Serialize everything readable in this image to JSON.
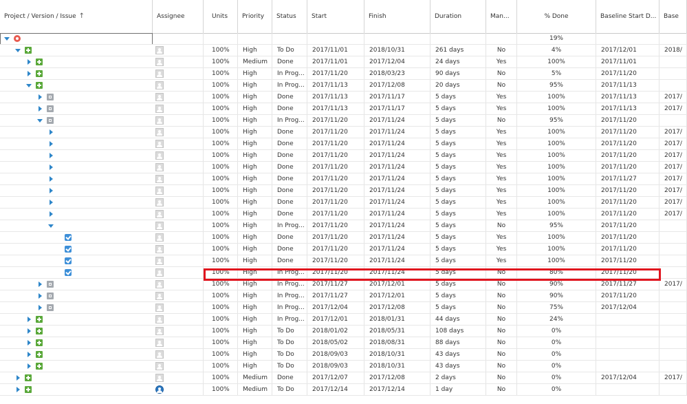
{
  "columns": [
    {
      "key": "tree",
      "label": "Project / Version / Issue",
      "sort_icon": "↑"
    },
    {
      "key": "assignee",
      "label": "Assignee"
    },
    {
      "key": "units",
      "label": "Units"
    },
    {
      "key": "priority",
      "label": "Priority"
    },
    {
      "key": "status",
      "label": "Status"
    },
    {
      "key": "start",
      "label": "Start"
    },
    {
      "key": "finish",
      "label": "Finish"
    },
    {
      "key": "duration",
      "label": "Duration"
    },
    {
      "key": "manual",
      "label": "Man..."
    },
    {
      "key": "done",
      "label": "% Done"
    },
    {
      "key": "bstart",
      "label": "Baseline Start D..."
    },
    {
      "key": "base",
      "label": "Base"
    }
  ],
  "colors": {
    "accent": "#2e86c9",
    "highlight": "#e0141e",
    "epic": "#5aa83a"
  },
  "rows": [
    {
      "level": 0,
      "toggle": "down",
      "icon": "project-icon",
      "avatar": "",
      "units": "",
      "priority": "",
      "status": "",
      "start": "",
      "finish": "",
      "duration": "",
      "manual": "",
      "done": "19%",
      "bstart": "",
      "base": ""
    },
    {
      "level": 1,
      "toggle": "down",
      "icon": "epic-icon",
      "avatar": "default",
      "units": "100%",
      "priority": "High",
      "status": "To Do",
      "start": "2017/11/01",
      "finish": "2018/10/31",
      "duration": "261 days",
      "manual": "No",
      "done": "4%",
      "bstart": "2017/12/01",
      "base": "2018/"
    },
    {
      "level": 2,
      "toggle": "right",
      "icon": "epic-icon",
      "avatar": "default",
      "units": "100%",
      "priority": "Medium",
      "status": "Done",
      "start": "2017/11/01",
      "finish": "2017/12/04",
      "duration": "24 days",
      "manual": "Yes",
      "done": "100%",
      "bstart": "2017/11/01",
      "base": ""
    },
    {
      "level": 2,
      "toggle": "right",
      "icon": "epic-icon",
      "avatar": "default",
      "units": "100%",
      "priority": "High",
      "status": "In Prog...",
      "start": "2017/11/20",
      "finish": "2018/03/23",
      "duration": "90 days",
      "manual": "No",
      "done": "5%",
      "bstart": "2017/11/20",
      "base": ""
    },
    {
      "level": 2,
      "toggle": "down",
      "icon": "epic-icon",
      "avatar": "default",
      "units": "100%",
      "priority": "High",
      "status": "In Prog...",
      "start": "2017/11/13",
      "finish": "2017/12/08",
      "duration": "20 days",
      "manual": "No",
      "done": "95%",
      "bstart": "2017/11/13",
      "base": ""
    },
    {
      "level": 3,
      "toggle": "right",
      "icon": "task-icon",
      "avatar": "default",
      "units": "100%",
      "priority": "High",
      "status": "Done",
      "start": "2017/11/13",
      "finish": "2017/11/17",
      "duration": "5 days",
      "manual": "Yes",
      "done": "100%",
      "bstart": "2017/11/13",
      "base": "2017/"
    },
    {
      "level": 3,
      "toggle": "right",
      "icon": "task-icon",
      "avatar": "default",
      "units": "100%",
      "priority": "High",
      "status": "Done",
      "start": "2017/11/13",
      "finish": "2017/11/17",
      "duration": "5 days",
      "manual": "Yes",
      "done": "100%",
      "bstart": "2017/11/13",
      "base": "2017/"
    },
    {
      "level": 3,
      "toggle": "down",
      "icon": "task-icon",
      "avatar": "default",
      "units": "100%",
      "priority": "High",
      "status": "In Prog...",
      "start": "2017/11/20",
      "finish": "2017/11/24",
      "duration": "5 days",
      "manual": "No",
      "done": "95%",
      "bstart": "2017/11/20",
      "base": ""
    },
    {
      "level": 4,
      "toggle": "right",
      "icon": "",
      "avatar": "default",
      "units": "100%",
      "priority": "High",
      "status": "Done",
      "start": "2017/11/20",
      "finish": "2017/11/24",
      "duration": "5 days",
      "manual": "Yes",
      "done": "100%",
      "bstart": "2017/11/20",
      "base": "2017/"
    },
    {
      "level": 4,
      "toggle": "right",
      "icon": "",
      "avatar": "default",
      "units": "100%",
      "priority": "High",
      "status": "Done",
      "start": "2017/11/20",
      "finish": "2017/11/24",
      "duration": "5 days",
      "manual": "Yes",
      "done": "100%",
      "bstart": "2017/11/20",
      "base": "2017/"
    },
    {
      "level": 4,
      "toggle": "right",
      "icon": "",
      "avatar": "default",
      "units": "100%",
      "priority": "High",
      "status": "Done",
      "start": "2017/11/20",
      "finish": "2017/11/24",
      "duration": "5 days",
      "manual": "Yes",
      "done": "100%",
      "bstart": "2017/11/20",
      "base": "2017/"
    },
    {
      "level": 4,
      "toggle": "right",
      "icon": "",
      "avatar": "default",
      "units": "100%",
      "priority": "High",
      "status": "Done",
      "start": "2017/11/20",
      "finish": "2017/11/24",
      "duration": "5 days",
      "manual": "Yes",
      "done": "100%",
      "bstart": "2017/11/20",
      "base": "2017/"
    },
    {
      "level": 4,
      "toggle": "right",
      "icon": "",
      "avatar": "default",
      "units": "100%",
      "priority": "High",
      "status": "Done",
      "start": "2017/11/20",
      "finish": "2017/11/24",
      "duration": "5 days",
      "manual": "Yes",
      "done": "100%",
      "bstart": "2017/11/27",
      "base": "2017/"
    },
    {
      "level": 4,
      "toggle": "right",
      "icon": "",
      "avatar": "default",
      "units": "100%",
      "priority": "High",
      "status": "Done",
      "start": "2017/11/20",
      "finish": "2017/11/24",
      "duration": "5 days",
      "manual": "Yes",
      "done": "100%",
      "bstart": "2017/11/20",
      "base": "2017/"
    },
    {
      "level": 4,
      "toggle": "right",
      "icon": "",
      "avatar": "default",
      "units": "100%",
      "priority": "High",
      "status": "Done",
      "start": "2017/11/20",
      "finish": "2017/11/24",
      "duration": "5 days",
      "manual": "Yes",
      "done": "100%",
      "bstart": "2017/11/20",
      "base": "2017/"
    },
    {
      "level": 4,
      "toggle": "right",
      "icon": "",
      "avatar": "default",
      "units": "100%",
      "priority": "High",
      "status": "Done",
      "start": "2017/11/20",
      "finish": "2017/11/24",
      "duration": "5 days",
      "manual": "Yes",
      "done": "100%",
      "bstart": "2017/11/20",
      "base": "2017/"
    },
    {
      "level": 4,
      "toggle": "down",
      "icon": "",
      "avatar": "default",
      "units": "100%",
      "priority": "High",
      "status": "In Prog...",
      "start": "2017/11/20",
      "finish": "2017/11/24",
      "duration": "5 days",
      "manual": "No",
      "done": "95%",
      "bstart": "2017/11/20",
      "base": ""
    },
    {
      "level": 5,
      "toggle": "",
      "icon": "subtask-icon",
      "avatar": "default",
      "units": "100%",
      "priority": "High",
      "status": "Done",
      "start": "2017/11/20",
      "finish": "2017/11/24",
      "duration": "5 days",
      "manual": "Yes",
      "done": "100%",
      "bstart": "2017/11/20",
      "base": ""
    },
    {
      "level": 5,
      "toggle": "",
      "icon": "subtask-icon",
      "avatar": "default",
      "units": "100%",
      "priority": "High",
      "status": "Done",
      "start": "2017/11/20",
      "finish": "2017/11/24",
      "duration": "5 days",
      "manual": "Yes",
      "done": "100%",
      "bstart": "2017/11/20",
      "base": ""
    },
    {
      "level": 5,
      "toggle": "",
      "icon": "subtask-icon",
      "avatar": "default",
      "units": "100%",
      "priority": "High",
      "status": "Done",
      "start": "2017/11/20",
      "finish": "2017/11/24",
      "duration": "5 days",
      "manual": "Yes",
      "done": "100%",
      "bstart": "2017/11/20",
      "base": ""
    },
    {
      "level": 5,
      "toggle": "",
      "icon": "subtask-icon",
      "avatar": "default",
      "units": "100%",
      "priority": "High",
      "status": "In Prog...",
      "start": "2017/11/20",
      "finish": "2017/11/24",
      "duration": "5 days",
      "manual": "No",
      "done": "80%",
      "bstart": "2017/11/20",
      "base": ""
    },
    {
      "level": 3,
      "toggle": "right",
      "icon": "task-icon",
      "avatar": "default",
      "units": "100%",
      "priority": "High",
      "status": "In Prog...",
      "start": "2017/11/27",
      "finish": "2017/12/01",
      "duration": "5 days",
      "manual": "No",
      "done": "90%",
      "bstart": "2017/11/27",
      "base": "2017/"
    },
    {
      "level": 3,
      "toggle": "right",
      "icon": "task-icon",
      "avatar": "default",
      "units": "100%",
      "priority": "High",
      "status": "In Prog...",
      "start": "2017/11/27",
      "finish": "2017/12/01",
      "duration": "5 days",
      "manual": "No",
      "done": "90%",
      "bstart": "2017/11/20",
      "base": ""
    },
    {
      "level": 3,
      "toggle": "right",
      "icon": "task-icon",
      "avatar": "default",
      "units": "100%",
      "priority": "High",
      "status": "In Prog...",
      "start": "2017/12/04",
      "finish": "2017/12/08",
      "duration": "5 days",
      "manual": "No",
      "done": "75%",
      "bstart": "2017/12/04",
      "base": ""
    },
    {
      "level": 2,
      "toggle": "right",
      "icon": "epic-icon",
      "avatar": "default",
      "units": "100%",
      "priority": "High",
      "status": "In Prog...",
      "start": "2017/12/01",
      "finish": "2018/01/31",
      "duration": "44 days",
      "manual": "No",
      "done": "24%",
      "bstart": "",
      "base": ""
    },
    {
      "level": 2,
      "toggle": "right",
      "icon": "epic-icon",
      "avatar": "default",
      "units": "100%",
      "priority": "High",
      "status": "To Do",
      "start": "2018/01/02",
      "finish": "2018/05/31",
      "duration": "108 days",
      "manual": "No",
      "done": "0%",
      "bstart": "",
      "base": ""
    },
    {
      "level": 2,
      "toggle": "right",
      "icon": "epic-icon",
      "avatar": "default",
      "units": "100%",
      "priority": "High",
      "status": "To Do",
      "start": "2018/05/02",
      "finish": "2018/08/31",
      "duration": "88 days",
      "manual": "No",
      "done": "0%",
      "bstart": "",
      "base": ""
    },
    {
      "level": 2,
      "toggle": "right",
      "icon": "epic-icon",
      "avatar": "default",
      "units": "100%",
      "priority": "High",
      "status": "To Do",
      "start": "2018/09/03",
      "finish": "2018/10/31",
      "duration": "43 days",
      "manual": "No",
      "done": "0%",
      "bstart": "",
      "base": ""
    },
    {
      "level": 2,
      "toggle": "right",
      "icon": "epic-icon",
      "avatar": "default",
      "units": "100%",
      "priority": "High",
      "status": "To Do",
      "start": "2018/09/03",
      "finish": "2018/10/31",
      "duration": "43 days",
      "manual": "No",
      "done": "0%",
      "bstart": "",
      "base": ""
    },
    {
      "level": 1,
      "toggle": "right",
      "icon": "epic-icon",
      "avatar": "default",
      "units": "100%",
      "priority": "Medium",
      "status": "Done",
      "start": "2017/12/07",
      "finish": "2017/12/08",
      "duration": "2 days",
      "manual": "No",
      "done": "0%",
      "bstart": "2017/12/04",
      "base": "2017/"
    },
    {
      "level": 1,
      "toggle": "right",
      "icon": "epic-icon",
      "avatar": "user",
      "units": "100%",
      "priority": "Medium",
      "status": "To Do",
      "start": "2017/12/14",
      "finish": "2017/12/14",
      "duration": "1 day",
      "manual": "No",
      "done": "0%",
      "bstart": "",
      "base": ""
    }
  ]
}
